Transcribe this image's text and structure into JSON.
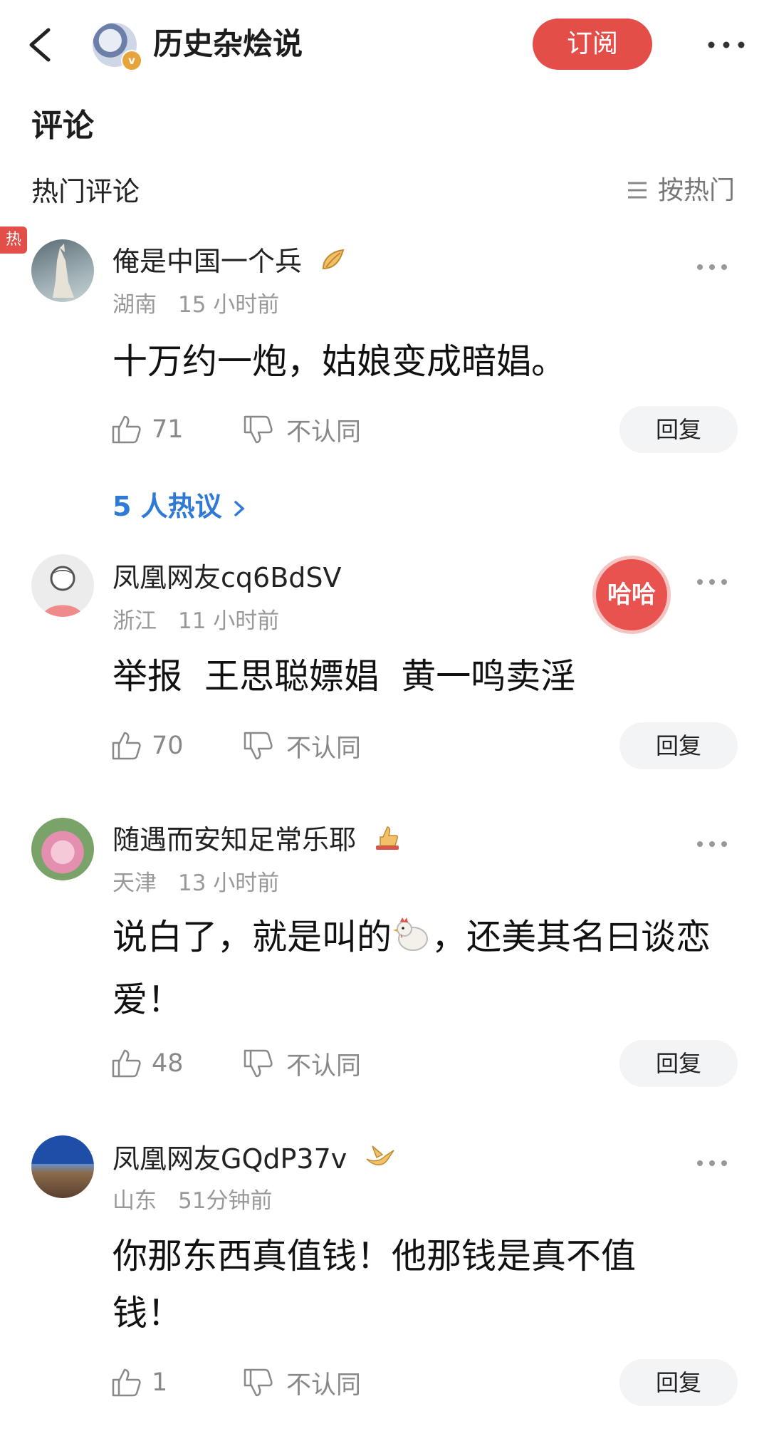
{
  "header": {
    "account_name": "历史杂烩说",
    "subscribe_label": "订阅"
  },
  "section_title": "评论",
  "hot_comments_label": "热门评论",
  "sort_label": "按热门",
  "hot_tag": "热",
  "hot_discussion": "5 人热议",
  "stamp_text": "哈哈",
  "comments": [
    {
      "username": "俺是中国一个兵",
      "location": "湖南",
      "time": "15 小时前",
      "text": "十万约一炮，姑娘变成暗娼。",
      "likes": "71",
      "dislike_label": "不认同",
      "reply_label": "回复"
    },
    {
      "username": "凤凰网友cq6BdSV",
      "location": "浙江",
      "time": "11 小时前",
      "text": "举报  王思聪嫖娼  黄一鸣卖淫",
      "likes": "70",
      "dislike_label": "不认同",
      "reply_label": "回复"
    },
    {
      "username": "随遇而安知足常乐耶",
      "location": "天津",
      "time": "13 小时前",
      "text_before": "说白了，就是叫的",
      "text_after": "，还美其名曰谈恋爱！",
      "likes": "48",
      "dislike_label": "不认同",
      "reply_label": "回复"
    },
    {
      "username": "凤凰网友GQdP37v",
      "location": "山东",
      "time": "51分钟前",
      "text": "你那东西真值钱！他那钱是真不值钱！",
      "likes": "1",
      "dislike_label": "不认同",
      "reply_label": "回复"
    }
  ],
  "colors": {
    "accent_red": "#e34e49",
    "link_blue": "#2f7ad6",
    "meta_gray": "#999999"
  }
}
